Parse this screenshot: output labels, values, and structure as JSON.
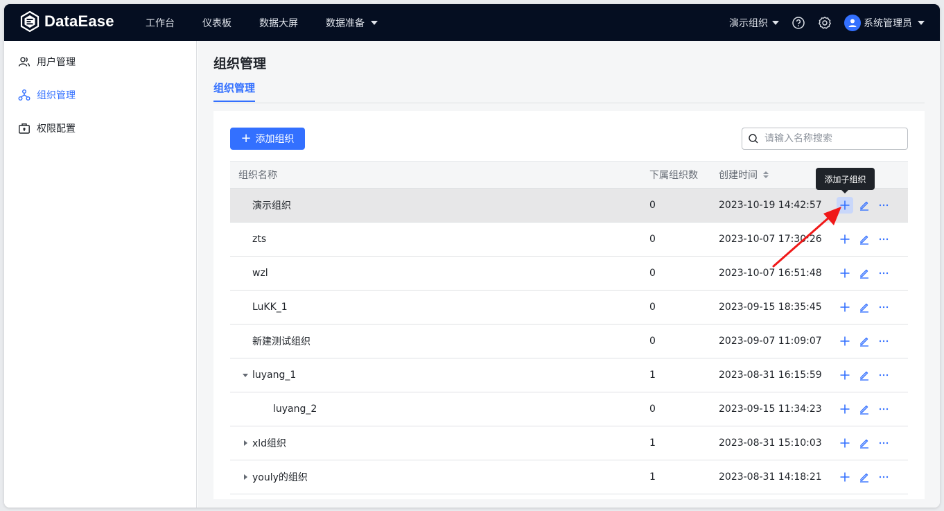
{
  "app": {
    "brand": "DataEase",
    "accent": "#3370ff"
  },
  "nav": {
    "items": [
      "工作台",
      "仪表板",
      "数据大屏",
      "数据准备"
    ],
    "org_switch": "演示组织",
    "user_name": "系统管理员"
  },
  "sidebar": {
    "items": [
      {
        "label": "用户管理",
        "icon": "users-icon"
      },
      {
        "label": "组织管理",
        "icon": "org-tree-icon",
        "active": true
      },
      {
        "label": "权限配置",
        "icon": "lock-briefcase-icon"
      }
    ]
  },
  "page": {
    "title": "组织管理",
    "tab": "组织管理",
    "add_button": "添加组织",
    "search_placeholder": "请输入名称搜索"
  },
  "table": {
    "headers": {
      "name": "组织名称",
      "count": "下属组织数",
      "time": "创建时间"
    },
    "rows": [
      {
        "name": "演示组织",
        "count": "0",
        "time": "2023-10-19 14:42:57",
        "level": 0,
        "expand": "none"
      },
      {
        "name": "zts",
        "count": "0",
        "time": "2023-10-07 17:30:26",
        "level": 0,
        "expand": "none"
      },
      {
        "name": "wzl",
        "count": "0",
        "time": "2023-10-07 16:51:48",
        "level": 0,
        "expand": "none"
      },
      {
        "name": "LuKK_1",
        "count": "0",
        "time": "2023-09-15 18:35:45",
        "level": 0,
        "expand": "none"
      },
      {
        "name": "新建测试组织",
        "count": "0",
        "time": "2023-09-07 11:09:07",
        "level": 0,
        "expand": "none"
      },
      {
        "name": "luyang_1",
        "count": "1",
        "time": "2023-08-31 16:15:59",
        "level": 0,
        "expand": "expanded"
      },
      {
        "name": "luyang_2",
        "count": "0",
        "time": "2023-09-15 11:34:23",
        "level": 1,
        "expand": "none"
      },
      {
        "name": "xld组织",
        "count": "1",
        "time": "2023-08-31 15:10:03",
        "level": 0,
        "expand": "collapsed"
      },
      {
        "name": "youly的组织",
        "count": "1",
        "time": "2023-08-31 14:18:21",
        "level": 0,
        "expand": "collapsed"
      }
    ]
  },
  "tooltip": {
    "text": "添加子组织"
  }
}
